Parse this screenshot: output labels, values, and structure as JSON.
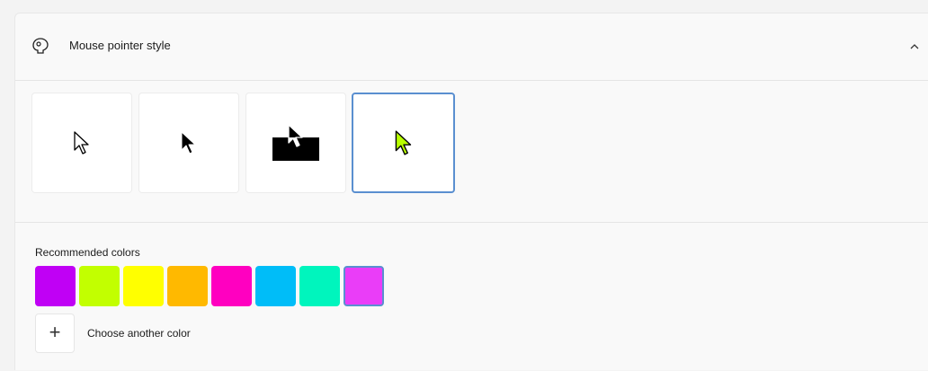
{
  "section": {
    "title": "Mouse pointer style",
    "icon": "pointer-style-icon",
    "expanded_icon": "chevron-up-icon"
  },
  "pointer_styles": [
    {
      "name": "white",
      "icon": "white-arrow-cursor",
      "selected": false
    },
    {
      "name": "black",
      "icon": "black-arrow-cursor",
      "selected": false
    },
    {
      "name": "inverted",
      "icon": "inverted-arrow-cursor",
      "selected": false
    },
    {
      "name": "custom",
      "icon": "custom-color-arrow-cursor",
      "selected": true,
      "color": "#b9ff00"
    }
  ],
  "colors": {
    "label": "Recommended colors",
    "swatches": [
      "#c000f5",
      "#c2ff00",
      "#ffff00",
      "#ffb900",
      "#ff00c0",
      "#00bdf8",
      "#00f5bd",
      "#ea3df8"
    ],
    "selected_index": 7,
    "add_label": "+",
    "choose_label": "Choose another color"
  }
}
